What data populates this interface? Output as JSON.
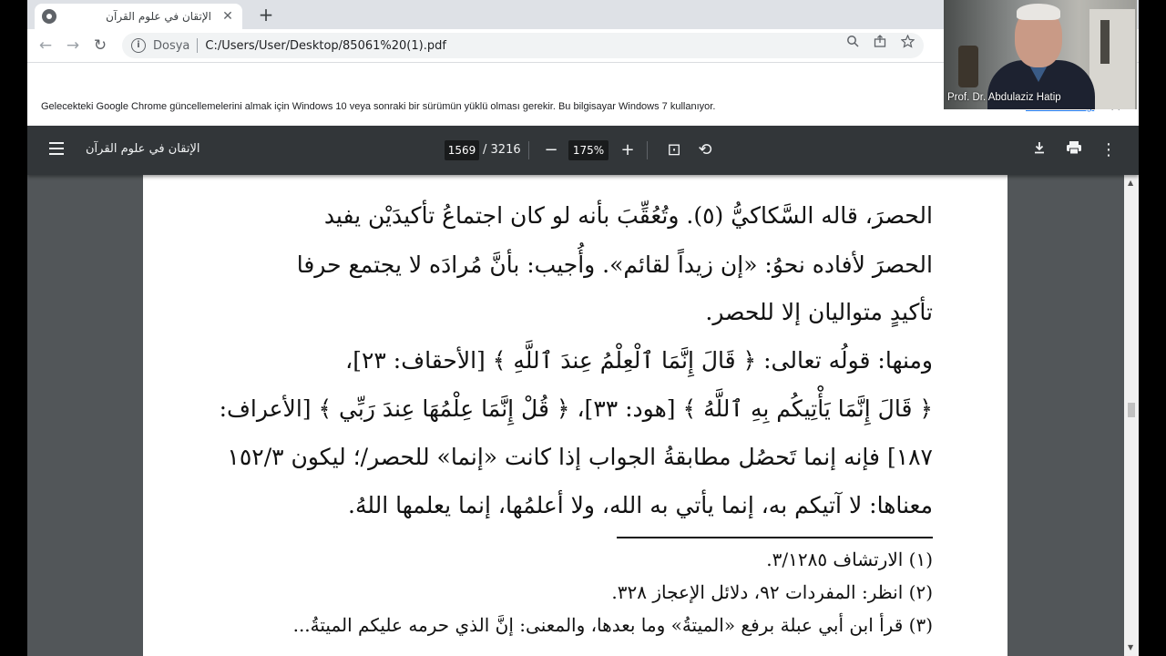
{
  "browser": {
    "tab_title": "الإتقان في علوم القرآن",
    "tab_close": "✕",
    "new_tab": "+",
    "nav": {
      "back": "←",
      "forward": "→",
      "reload": "↻"
    },
    "omnibox": {
      "info": "i",
      "scheme_label": "Dosya",
      "url": "C:/Users/User/Desktop/85061%20(1).pdf"
    },
    "omnibox_icons": {
      "zoom": "zoom-icon",
      "share": "share-icon",
      "bookmark": "star-icon"
    }
  },
  "infobar": {
    "message": "Gelecekteki Google Chrome güncellemelerini almak için Windows 10 veya sonraki bir sürümün yüklü olması gerekir. Bu bilgisayar Windows 7 kullanıyor.",
    "link": "Daha fazla bilgi",
    "close": "✕"
  },
  "pdf_toolbar": {
    "title": "الإتقان في علوم القرآن",
    "current_page": "1569",
    "page_sep": "/",
    "total_pages": "3216",
    "zoom_out": "−",
    "zoom": "175%",
    "zoom_in": "+",
    "fit": "⊡",
    "rotate": "⟲",
    "download": "⭳",
    "print": "⎙",
    "more": "⋮"
  },
  "document": {
    "lines": [
      "الحصرَ، قاله السَّكاكيُّ (٥). وتُعُقِّبَ بأنه لو كان اجتماعُ تأكيدَيْن يفيد",
      "الحصرَ لأفاده نحوُ: «إن زيداً لقائم». وأُجيب: بأنَّ مُرادَه لا يجتمع حرفا",
      "تأكيدٍ متواليان إلا للحصر.",
      "ومنها: قولُه تعالى: ﴿ قَالَ إِنَّمَا ٱلْعِلْمُ عِندَ ٱللَّهِ ﴾ [الأحقاف: ٢٣]،",
      "﴿ قَالَ إِنَّمَا يَأْتِيكُم بِهِ ٱللَّهُ ﴾ [هود: ٣٣]، ﴿ قُلْ إِنَّمَا عِلْمُهَا عِندَ رَبِّي ﴾ [الأعراف:",
      "١٨٧] فإنه إنما تَحصُل مطابقةُ الجواب إذا كانت «إنما» للحصر/؛ ليكون ١٥٢/٣",
      "معناها: لا آتيكم به، إنما يأتي به الله، ولا أعلمُها، إنما يعلمها اللهُ."
    ],
    "footnotes": [
      "(١) الارتشاف ٣/١٢٨٥.",
      "(٢) انظر: المفردات ٩٢، دلائل الإعجاز ٣٢٨.",
      "(٣) قرأ ابن أبي عبلة برفع «الميتةُ» وما بعدها، والمعنى: إنَّ الذي حرمه عليكم الميتةُ..."
    ]
  },
  "webcam": {
    "name": "Prof. Dr. Abdulaziz Hatip"
  }
}
